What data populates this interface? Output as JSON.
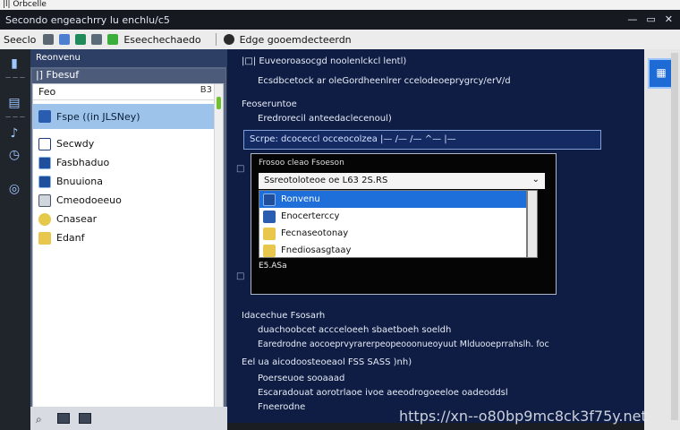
{
  "titlebar": {
    "text": "|l| Orbcelle"
  },
  "topbar": {
    "title": "Secondo engeachrry lu enchlu/c5"
  },
  "window_controls": {
    "minimize": "—",
    "restore": "▭",
    "close": "✕"
  },
  "toolbar": {
    "item1": "Seeclo",
    "item2": "Eseechechaedo",
    "item3": "Edge gooemdecteerdn"
  },
  "leftrail": {
    "label1": "— — —",
    "label2": "— — —"
  },
  "explorer": {
    "header": "Reonvenu",
    "breadcrumb": "|]  Fbesuf",
    "path_value": "Feo",
    "path_flag": "B3",
    "selected_item": "Fspe ((in JLSNey)",
    "items": [
      {
        "label": "Secwdy"
      },
      {
        "label": "Fasbhaduo"
      },
      {
        "label": "Bnuuiona"
      },
      {
        "label": "Cmeodoeeuo"
      },
      {
        "label": "Cnasear"
      },
      {
        "label": "Edanf"
      }
    ]
  },
  "terminal": {
    "l1": "|□| Euveoroasocgd   noolenlckcl lentl)",
    "l2": "Ecsdbcetock ar oleGordheenlrer ccelodeoeprygrcy/erV/d",
    "l3": "Feoseruntoe",
    "l4": "Eredrorecil anteedaclecenoul)",
    "input": "Scrpe: dcoceccl  occeocolzea   |—    /—    /—   ^—   |—",
    "l5": "Idacechue Fsosarh",
    "l6": "duachoobcet  accceloeeh  sbaetboeh soeldh",
    "l7": "Earedrodne  aocoeprvyrarerpeopeooonueoyuut  Mlduooeprrahslh. foc",
    "l8": "Eel  ua  aicodoosteoeaol  FSS   SASS  )nh)",
    "l9": "Poerseuoe  sooaaad",
    "l10": "Escaradouat aorotrlaoe ivoe  aeeodrogoeeloe  oadeoddsl",
    "l11": "Fneerodne"
  },
  "dialog": {
    "title": "Frosoo  cleao    Fsoeson",
    "field_value": "Ssreotoloteoe  oe   L63  2S.RS",
    "options": [
      {
        "label": "Ronvenu"
      },
      {
        "label": "Enocerterccy"
      },
      {
        "label": "Fecnaseotonay"
      },
      {
        "label": "Fnediosasgtaay"
      }
    ],
    "footer": "E5.ASa"
  },
  "rightpane": {
    "tile_icon": "▦"
  },
  "watermark": {
    "text": "https://xn--o80bp9mc8ck3f75y.net"
  },
  "colors": {
    "accent": "#1e6fd9",
    "terminal_bg": "#0f1d44",
    "selection": "#9dc3ea"
  }
}
